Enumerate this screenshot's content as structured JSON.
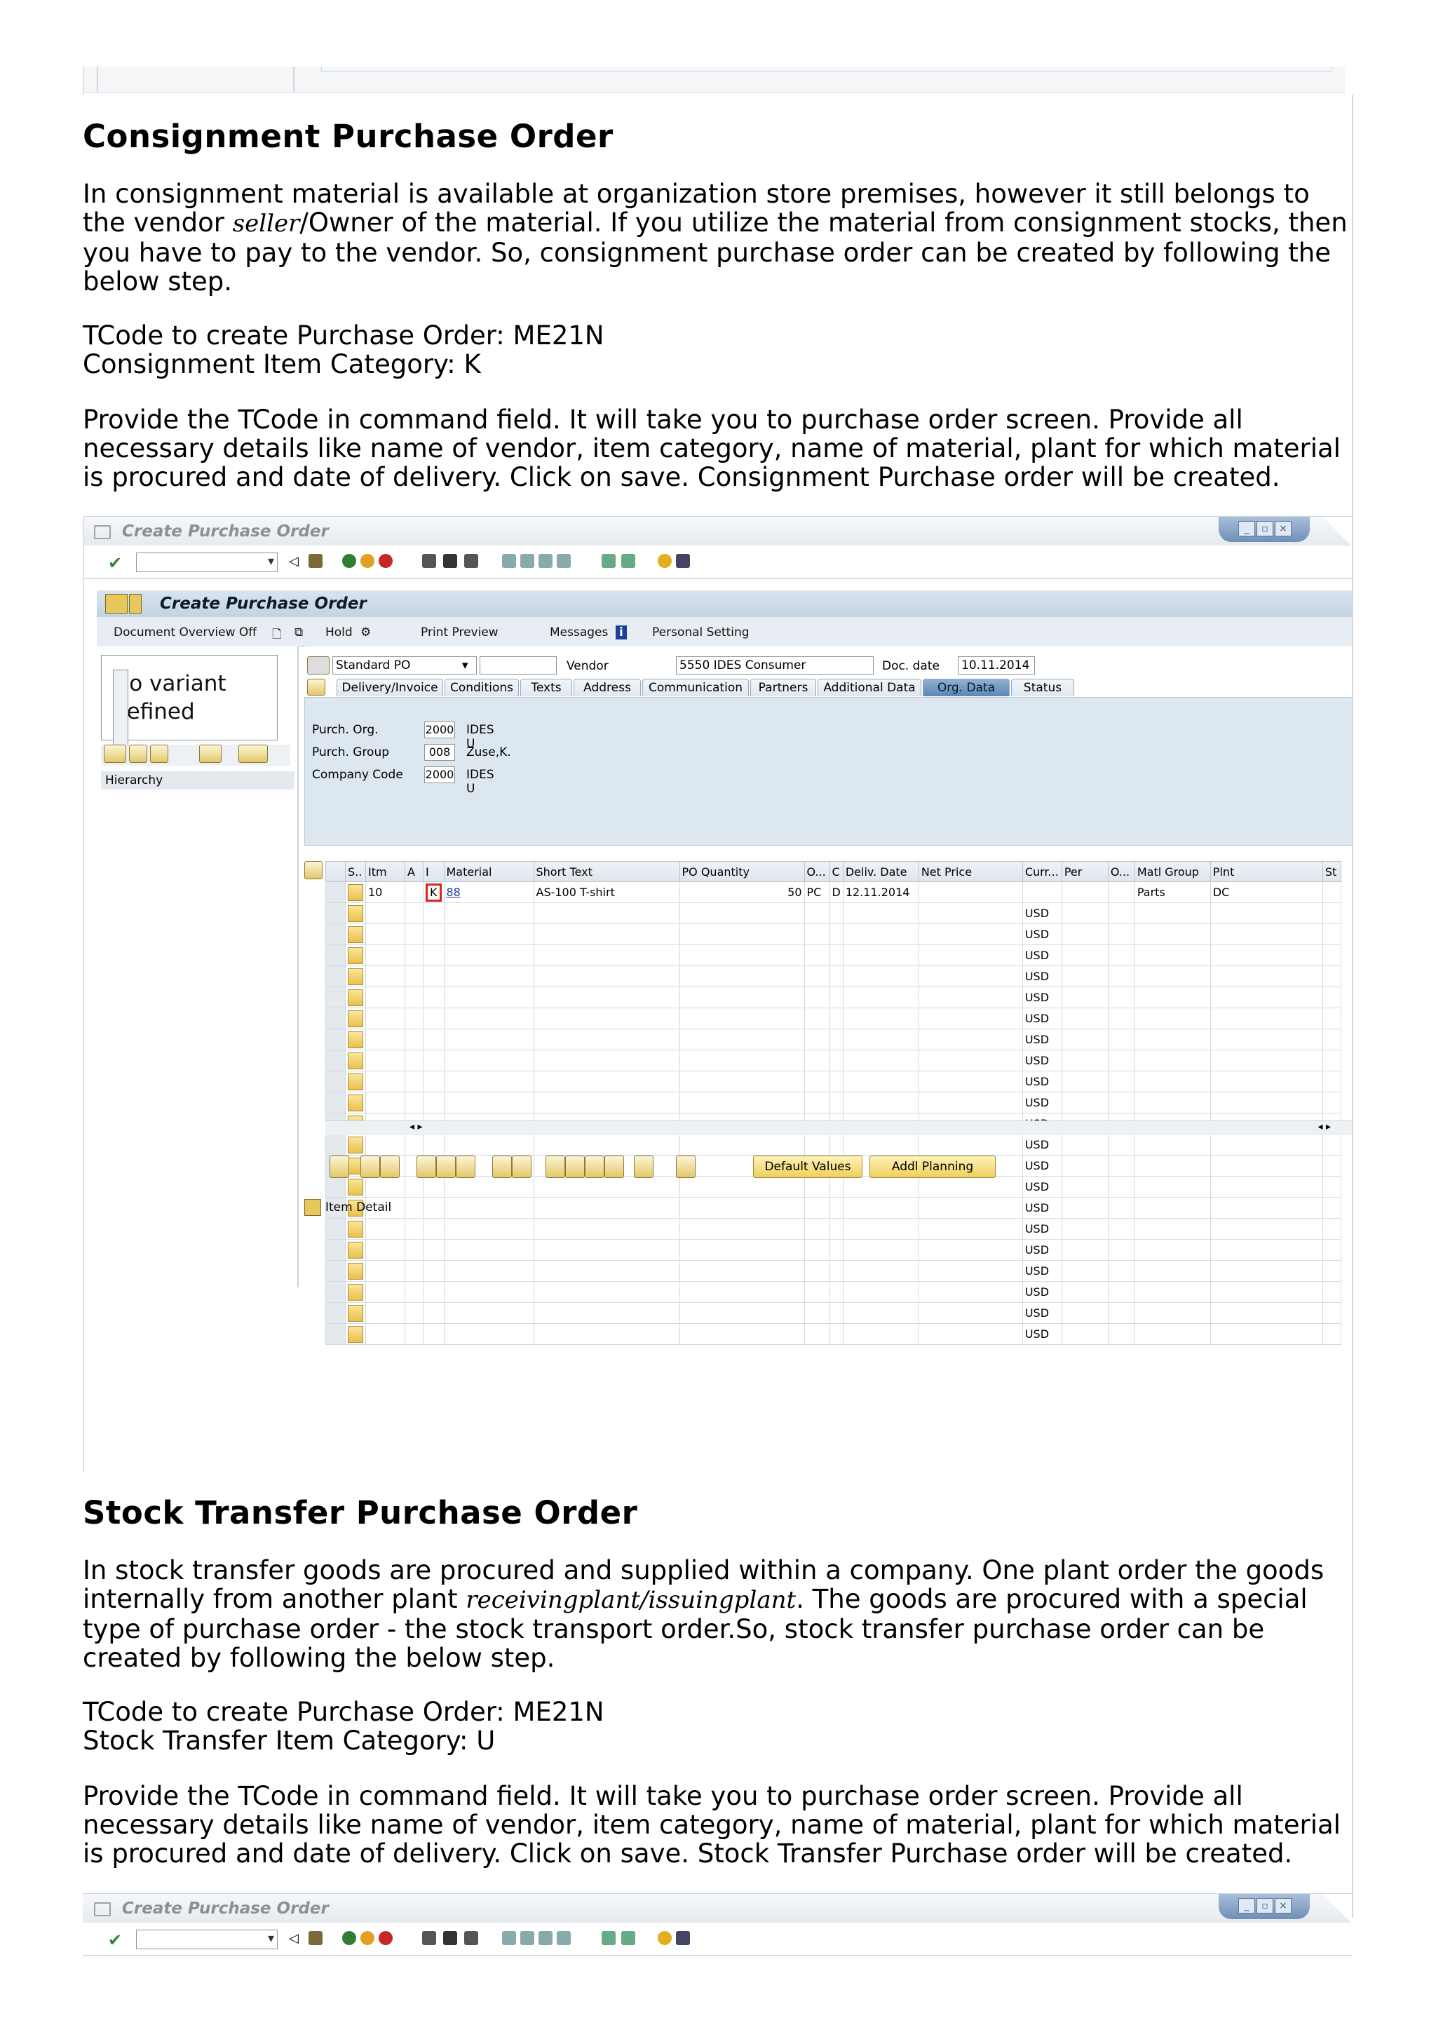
{
  "section1": {
    "heading": "Consignment Purchase Order",
    "intro_part1": "In consignment material is available at organization store premises, however it still belongs to the vendor ",
    "intro_italic": "seller",
    "intro_part2": "/Owner of the material. If you utilize the material from consignment stocks, then you have to pay to the vendor. So, consignment purchase order can be created by following the below step.",
    "tcode": "TCode to create Purchase Order: ME21N",
    "category": "Consignment Item Category: K",
    "instructions": "Provide the TCode in command field. It will take you to purchase order screen. Provide all necessary details like name of vendor, item category, name of material, plant for which material is procured and date of delivery. Click on save. Consignment Purchase order will be created."
  },
  "section2": {
    "heading": "Stock Transfer Purchase Order",
    "intro_part1": "In stock transfer goods are procured and supplied within a company. One plant order the goods internally from another plant ",
    "intro_italic": "receivingplant/issuingplant",
    "intro_part2": ". The goods are procured with a special type of purchase order - the stock transport order.So, stock transfer purchase order can be created by following the below step.",
    "tcode": "TCode to create Purchase Order: ME21N",
    "category": "Stock Transfer Item Category: U",
    "instructions": "Provide the TCode in command field. It will take you to purchase order screen. Provide all necessary details like name of vendor, item category, name of material, plant for which material is procured and date of delivery. Click on save. Stock Transfer Purchase order will be created."
  },
  "sap": {
    "window_title": "Create Purchase Order",
    "page_title": "Create Purchase Order",
    "app_toolbar": {
      "doc_overview": "Document Overview Off",
      "hold": "Hold",
      "print_preview": "Print Preview",
      "messages": "Messages",
      "personal_setting": "Personal Setting"
    },
    "variant_text": "No variant defined",
    "hierarchy": "Hierarchy",
    "header": {
      "po_type": "Standard PO",
      "vendor_label": "Vendor",
      "vendor_value": "5550 IDES Consumer",
      "doc_date_label": "Doc. date",
      "doc_date_value": "10.11.2014"
    },
    "tabs": [
      "Delivery/Invoice",
      "Conditions",
      "Texts",
      "Address",
      "Communication",
      "Partners",
      "Additional Data",
      "Org. Data",
      "Status"
    ],
    "active_tab": "Org. Data",
    "org": [
      {
        "label": "Purch. Org.",
        "value": "2000",
        "desc": "IDES U"
      },
      {
        "label": "Purch. Group",
        "value": "008",
        "desc": "Zuse,K."
      },
      {
        "label": "Company Code",
        "value": "2000",
        "desc": "IDES U"
      }
    ],
    "columns": [
      "S..",
      "Itm",
      "A",
      "I",
      "Material",
      "Short Text",
      "PO Quantity",
      "O...",
      "C",
      "Deliv. Date",
      "Net Price",
      "Curr...",
      "Per",
      "O...",
      "Matl Group",
      "Plnt",
      "St"
    ],
    "item": {
      "itm": "10",
      "i": "K",
      "material": "88",
      "short_text": "AS-100 T-shirt",
      "qty": "50",
      "unit": "PC",
      "c": "D",
      "deliv_date": "12.11.2014",
      "matl_group": "Parts",
      "plant": "DC"
    },
    "currency": "USD",
    "default_values": "Default Values",
    "addl_planning": "Addl Planning",
    "item_detail": "Item Detail"
  }
}
